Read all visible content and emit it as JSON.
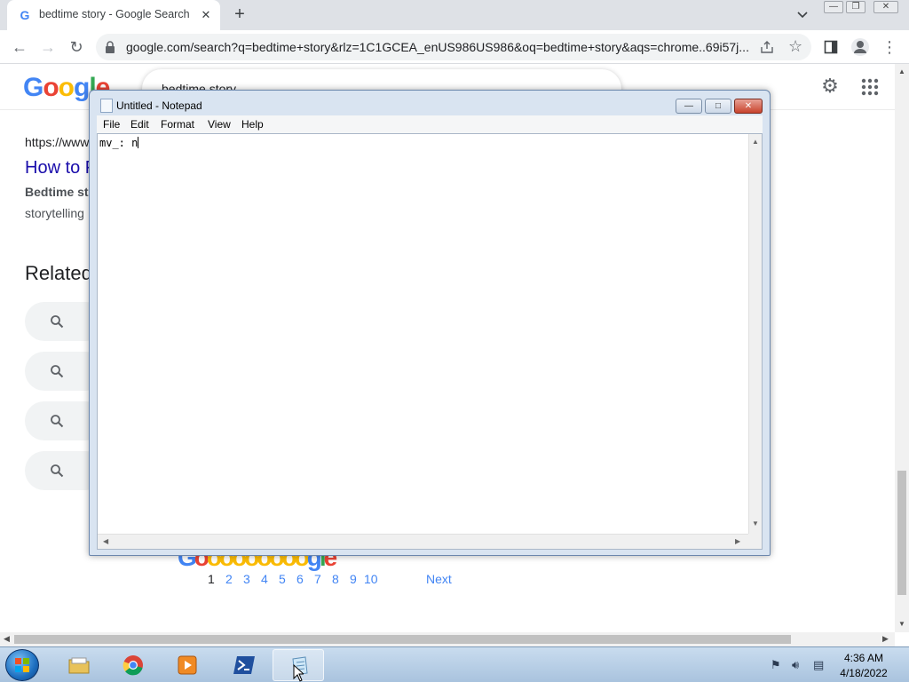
{
  "browser": {
    "tab_title": "bedtime story - Google Search",
    "tab_close": "✕",
    "new_tab": "+",
    "favicon_letter": "G",
    "url": "google.com/search?q=bedtime+story&rlz=1C1GCEA_enUS986US986&oq=bedtime+story&aqs=chrome..69i57j...",
    "window_controls": [
      "—",
      "❐",
      "✕"
    ]
  },
  "google": {
    "logo": [
      "G",
      "o",
      "o",
      "g",
      "l",
      "e"
    ],
    "logo_colors": [
      "#4285f4",
      "#ea4335",
      "#fbbc05",
      "#4285f4",
      "#34a853",
      "#ea4335"
    ],
    "query": "bedtime story",
    "clear": "✕",
    "result_url": "https://www",
    "result_title": "How to F",
    "snippet_bold": "Bedtime sto",
    "snippet": "storytelling",
    "related_heading": "Related",
    "pagination_logo": "Gooooooooogle",
    "pages": [
      "1",
      "2",
      "3",
      "4",
      "5",
      "6",
      "7",
      "8",
      "9",
      "10"
    ],
    "current_page": "1",
    "next": "Next"
  },
  "notepad": {
    "title": "Untitled - Notepad",
    "menu": [
      "File",
      "Edit",
      "Format",
      "View",
      "Help"
    ],
    "content": "mv_: n",
    "buttons": {
      "minimize": "—",
      "maximize": "□",
      "close": "✕"
    }
  },
  "taskbar": {
    "apps": [
      "Windows Explorer",
      "Google Chrome",
      "Windows Media Player",
      "Windows PowerShell",
      "Notepad"
    ],
    "time": "4:36 AM",
    "date": "4/18/2022"
  }
}
